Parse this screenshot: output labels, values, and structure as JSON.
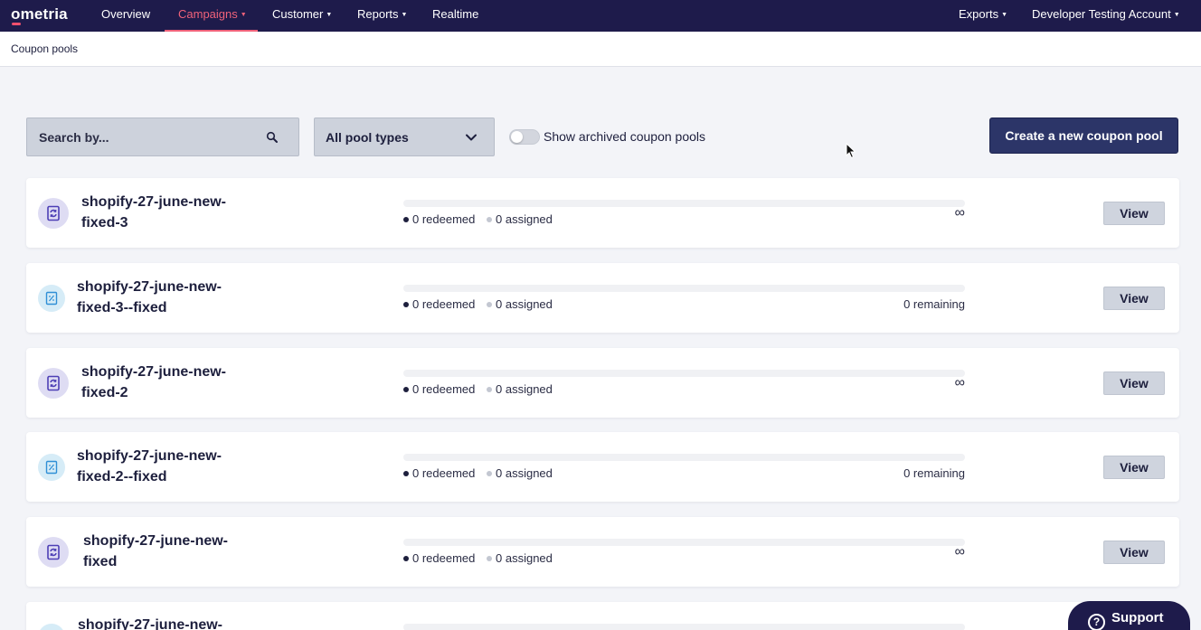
{
  "nav": {
    "logo": "ometria",
    "items": [
      {
        "label": "Overview"
      },
      {
        "label": "Campaigns",
        "active": true
      },
      {
        "label": "Customer"
      },
      {
        "label": "Reports"
      },
      {
        "label": "Realtime"
      }
    ],
    "right": [
      {
        "label": "Exports"
      },
      {
        "label": "Developer Testing Account"
      }
    ]
  },
  "breadcrumb": "Coupon pools",
  "toolbar": {
    "search_placeholder": "Search by...",
    "pool_type": "All pool types",
    "archived_label": "Show archived coupon pools",
    "archived_on": false,
    "create_label": "Create a new coupon pool"
  },
  "pools": [
    {
      "name": "shopify-27-june-new-fixed-3",
      "icon": "coupon-refresh-icon",
      "redeemed": "0 redeemed",
      "assigned": "0 assigned",
      "remaining": "∞",
      "view": "View"
    },
    {
      "name": "shopify-27-june-new-fixed-3--fixed",
      "icon": "coupon-discount-icon",
      "redeemed": "0 redeemed",
      "assigned": "0 assigned",
      "remaining": "0 remaining",
      "view": "View"
    },
    {
      "name": "shopify-27-june-new-fixed-2",
      "icon": "coupon-refresh-icon",
      "redeemed": "0 redeemed",
      "assigned": "0 assigned",
      "remaining": "∞",
      "view": "View"
    },
    {
      "name": "shopify-27-june-new-fixed-2--fixed",
      "icon": "coupon-discount-icon",
      "redeemed": "0 redeemed",
      "assigned": "0 assigned",
      "remaining": "0 remaining",
      "view": "View"
    },
    {
      "name": "shopify-27-june-new-fixed",
      "icon": "coupon-refresh-icon",
      "redeemed": "0 redeemed",
      "assigned": "0 assigned",
      "remaining": "∞",
      "view": "View"
    },
    {
      "name": "shopify-27-june-new-",
      "icon": "coupon-discount-icon",
      "redeemed": "",
      "assigned": "",
      "remaining": "",
      "view": ""
    }
  ],
  "support": {
    "label": "Support"
  },
  "colors": {
    "nav_bg": "#1e1b4b",
    "accent": "#f0627a",
    "primary_button": "#2c3568"
  }
}
